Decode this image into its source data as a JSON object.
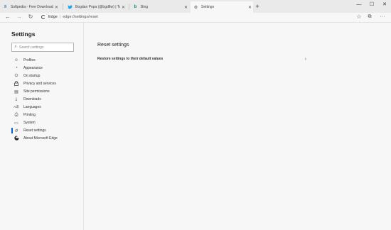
{
  "tabs": [
    {
      "title": "Softpedia - Free Downloads En",
      "icon": "softpedia-icon",
      "glyph": "S",
      "color": "#1b4fa0"
    },
    {
      "title": "Bogdan Popa (@bgdftw) | Twitt",
      "icon": "twitter-icon",
      "glyph": "🐦",
      "color": "#1da1f2"
    },
    {
      "title": "Bing",
      "icon": "bing-icon",
      "glyph": "b",
      "color": "#008373"
    },
    {
      "title": "Settings",
      "icon": "gear-icon",
      "glyph": "⚙",
      "color": "#555555"
    }
  ],
  "tab_close": "✕",
  "new_tab": "+",
  "window": {
    "minimize": "—",
    "maximize": "☐",
    "close": "✕"
  },
  "nav": {
    "back": "←",
    "forward": "→",
    "refresh": "↻",
    "brand": "Edge",
    "separator": "|",
    "url": "edge://settings/reset",
    "favorite": "☆",
    "share": "⧉",
    "more": "···"
  },
  "sidebar": {
    "title": "Settings",
    "search_placeholder": "Search settings",
    "items": [
      {
        "label": "Profiles",
        "icon": "person-icon",
        "glyph": "☺"
      },
      {
        "label": "Appearance",
        "icon": "palette-icon",
        "glyph": "◔"
      },
      {
        "label": "On startup",
        "icon": "power-icon",
        "glyph": "⏻"
      },
      {
        "label": "Privacy and services",
        "icon": "lock-icon",
        "glyph": "🔒"
      },
      {
        "label": "Site permissions",
        "icon": "permissions-icon",
        "glyph": "▤"
      },
      {
        "label": "Downloads",
        "icon": "download-icon",
        "glyph": "⤓"
      },
      {
        "label": "Languages",
        "icon": "languages-icon",
        "glyph": "Aあ"
      },
      {
        "label": "Printing",
        "icon": "printer-icon",
        "glyph": "⎙"
      },
      {
        "label": "System",
        "icon": "system-icon",
        "glyph": "▭"
      },
      {
        "label": "Reset settings",
        "icon": "reset-icon",
        "glyph": "↺",
        "selected": true
      },
      {
        "label": "About Microsoft Edge",
        "icon": "edge-logo-icon",
        "glyph": "e"
      }
    ]
  },
  "main": {
    "title": "Reset settings",
    "rows": [
      {
        "label": "Restore settings to their default values",
        "chevron": "›"
      }
    ]
  },
  "colors": {
    "accent": "#0a64c8",
    "background": "#f7f7f7",
    "tabstrip": "#eaeaea"
  }
}
